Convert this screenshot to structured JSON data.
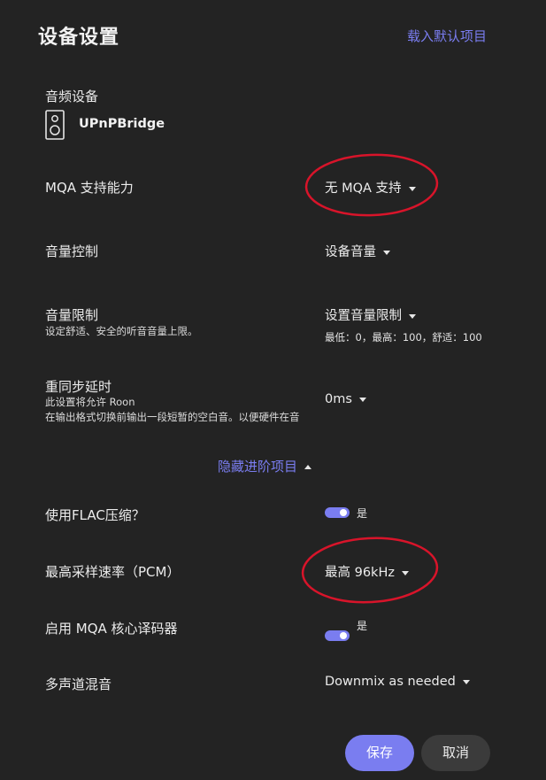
{
  "header": {
    "title": "设备设置",
    "load_default": "载入默认项目"
  },
  "audio_device": {
    "label": "音频设备",
    "name": "UPnPBridge",
    "icon": "speaker-icon"
  },
  "mqa_support": {
    "label": "MQA 支持能力",
    "value": "无 MQA 支持"
  },
  "volume_control": {
    "label": "音量控制",
    "value": "设备音量"
  },
  "volume_limit": {
    "label": "音量限制",
    "description": "设定舒适、安全的听音音量上限。",
    "value": "设置音量限制",
    "hint": "最低：0，最高：100，舒适：100"
  },
  "resync_delay": {
    "label": "重同步延时",
    "description_line1": "此设置将允许 Roon",
    "description_line2": "在输出格式切换前输出一段短暂的空白音。以便硬件在音",
    "value": "0ms"
  },
  "advanced_toggle": {
    "label": "隐藏进阶项目"
  },
  "flac_compression": {
    "label": "使用FLAC压缩？",
    "toggle_on": true,
    "state_label": "是"
  },
  "max_sample_rate": {
    "label": "最高采样速率（PCM）",
    "value": "最高 96kHz"
  },
  "mqa_core_decoder": {
    "label": "启用 MQA 核心译码器",
    "toggle_on": true,
    "state_label": "是"
  },
  "multichannel_mix": {
    "label": "多声道混音",
    "value": "Downmix as needed"
  },
  "buttons": {
    "save": "保存",
    "cancel": "取消"
  },
  "colors": {
    "background": "#232323",
    "accent": "#7a7df0",
    "annotation": "#d8142a"
  }
}
